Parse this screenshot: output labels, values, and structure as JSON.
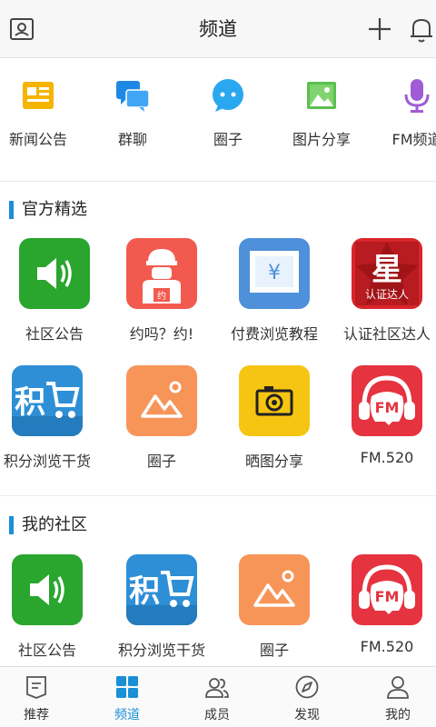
{
  "header": {
    "title": "频道",
    "left_icon": "profile-card-icon",
    "add_icon": "plus-icon",
    "bell_icon": "bell-icon"
  },
  "quick_links": [
    {
      "label": "新闻公告",
      "icon": "news-icon",
      "color": "#f5b400"
    },
    {
      "label": "群聊",
      "icon": "group-chat-icon",
      "color": "#1e88e5"
    },
    {
      "label": "圈子",
      "icon": "chat-bubble-icon",
      "color": "#29a8f0"
    },
    {
      "label": "图片分享",
      "icon": "image-icon",
      "color": "#5cbf50"
    },
    {
      "label": "FM频道",
      "icon": "microphone-icon",
      "color": "#a05cd6"
    }
  ],
  "sections": {
    "official": {
      "title": "官方精选",
      "items": [
        {
          "label": "社区公告",
          "icon": "speaker-icon",
          "color": "#2aa52e"
        },
        {
          "label": "约吗？约!",
          "icon": "courier-icon",
          "color": "#f25a4f",
          "badge": "约"
        },
        {
          "label": "付费浏览教程",
          "icon": "yen-screen-icon",
          "color": "#4e90d9",
          "symbol": "¥"
        },
        {
          "label": "认证社区达人",
          "icon": "star-badge-icon",
          "color": "#d8262a",
          "badge_main": "星",
          "badge_sub": "认证达人"
        },
        {
          "label": "积分浏览干货",
          "icon": "points-cart-icon",
          "color": "#2e8fd6",
          "badge": "积"
        },
        {
          "label": "圈子",
          "icon": "mountain-image-icon",
          "color": "#f79559"
        },
        {
          "label": "晒图分享",
          "icon": "camera-icon",
          "color": "#f6c512"
        },
        {
          "label": "FM.520",
          "icon": "fm-headphones-icon",
          "color": "#e63340",
          "badge": "FM"
        }
      ]
    },
    "mine": {
      "title": "我的社区",
      "items": [
        {
          "label": "社区公告",
          "icon": "speaker-icon",
          "color": "#2aa52e"
        },
        {
          "label": "积分浏览干货",
          "icon": "points-cart-icon",
          "color": "#2e8fd6",
          "badge": "积"
        },
        {
          "label": "圈子",
          "icon": "mountain-image-icon",
          "color": "#f79559"
        },
        {
          "label": "FM.520",
          "icon": "fm-headphones-icon",
          "color": "#e63340",
          "badge": "FM"
        }
      ]
    }
  },
  "bottom_nav": [
    {
      "label": "推荐",
      "icon": "document-icon",
      "active": false
    },
    {
      "label": "频道",
      "icon": "grid-icon",
      "active": true
    },
    {
      "label": "成员",
      "icon": "members-icon",
      "active": false
    },
    {
      "label": "发现",
      "icon": "compass-icon",
      "active": false
    },
    {
      "label": "我的",
      "icon": "user-icon",
      "active": false
    }
  ],
  "colors": {
    "accent": "#1a8fd8",
    "text": "#333333",
    "header_bg": "#f7f7f7"
  }
}
